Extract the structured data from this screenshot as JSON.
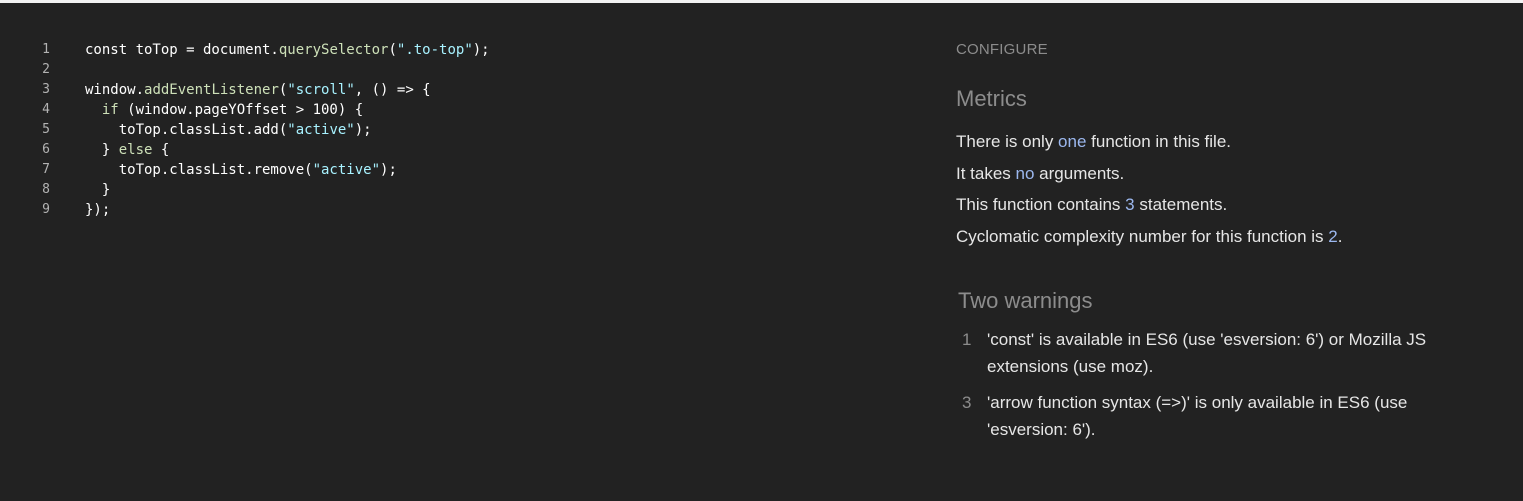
{
  "editor": {
    "lines": [
      {
        "num": "1",
        "tokens": [
          {
            "t": "const toTop = document.",
            "c": "plain"
          },
          {
            "t": "querySelector",
            "c": "method"
          },
          {
            "t": "(",
            "c": "plain"
          },
          {
            "t": "\".to-top\"",
            "c": "str"
          },
          {
            "t": ");",
            "c": "plain"
          }
        ]
      },
      {
        "num": "2",
        "tokens": []
      },
      {
        "num": "3",
        "tokens": [
          {
            "t": "window.",
            "c": "plain"
          },
          {
            "t": "addEventListener",
            "c": "method"
          },
          {
            "t": "(",
            "c": "plain"
          },
          {
            "t": "\"scroll\"",
            "c": "str"
          },
          {
            "t": ", () => {",
            "c": "plain"
          }
        ]
      },
      {
        "num": "4",
        "tokens": [
          {
            "t": "  ",
            "c": "plain"
          },
          {
            "t": "if",
            "c": "method"
          },
          {
            "t": " (window.pageYOffset > 100) {",
            "c": "plain"
          }
        ]
      },
      {
        "num": "5",
        "tokens": [
          {
            "t": "    toTop.classList.add(",
            "c": "plain"
          },
          {
            "t": "\"active\"",
            "c": "str"
          },
          {
            "t": ");",
            "c": "plain"
          }
        ]
      },
      {
        "num": "6",
        "tokens": [
          {
            "t": "  } ",
            "c": "plain"
          },
          {
            "t": "else",
            "c": "method"
          },
          {
            "t": " {",
            "c": "plain"
          }
        ]
      },
      {
        "num": "7",
        "tokens": [
          {
            "t": "    toTop.classList.remove(",
            "c": "plain"
          },
          {
            "t": "\"active\"",
            "c": "str"
          },
          {
            "t": ");",
            "c": "plain"
          }
        ]
      },
      {
        "num": "8",
        "tokens": [
          {
            "t": "  }",
            "c": "plain"
          }
        ]
      },
      {
        "num": "9",
        "tokens": [
          {
            "t": "});",
            "c": "plain"
          }
        ]
      }
    ]
  },
  "report": {
    "configure_label": "CONFIGURE",
    "metrics": {
      "title": "Metrics",
      "line1": {
        "pre": "There is only ",
        "hl": "one",
        "post": " function in this file."
      },
      "line2": {
        "pre": "It takes ",
        "hl": "no",
        "post": " arguments."
      },
      "line3": {
        "pre": "This function contains ",
        "hl": "3",
        "post": " statements."
      },
      "line4": {
        "pre": "Cyclomatic complexity number for this function is ",
        "hl": "2",
        "post": "."
      }
    },
    "warnings": {
      "title": "Two warnings",
      "items": [
        {
          "line": "1",
          "text": "'const' is available in ES6 (use 'esversion: 6') or Mozilla JS extensions (use moz)."
        },
        {
          "line": "3",
          "text": "'arrow function syntax (=>)' is only available in ES6 (use 'esversion: 6')."
        }
      ]
    }
  },
  "colors": {
    "background": "#222222",
    "string": "#a8f2ff",
    "method": "#cde0b8",
    "highlight": "#9cb8ef",
    "muted": "#8c8c8c"
  }
}
